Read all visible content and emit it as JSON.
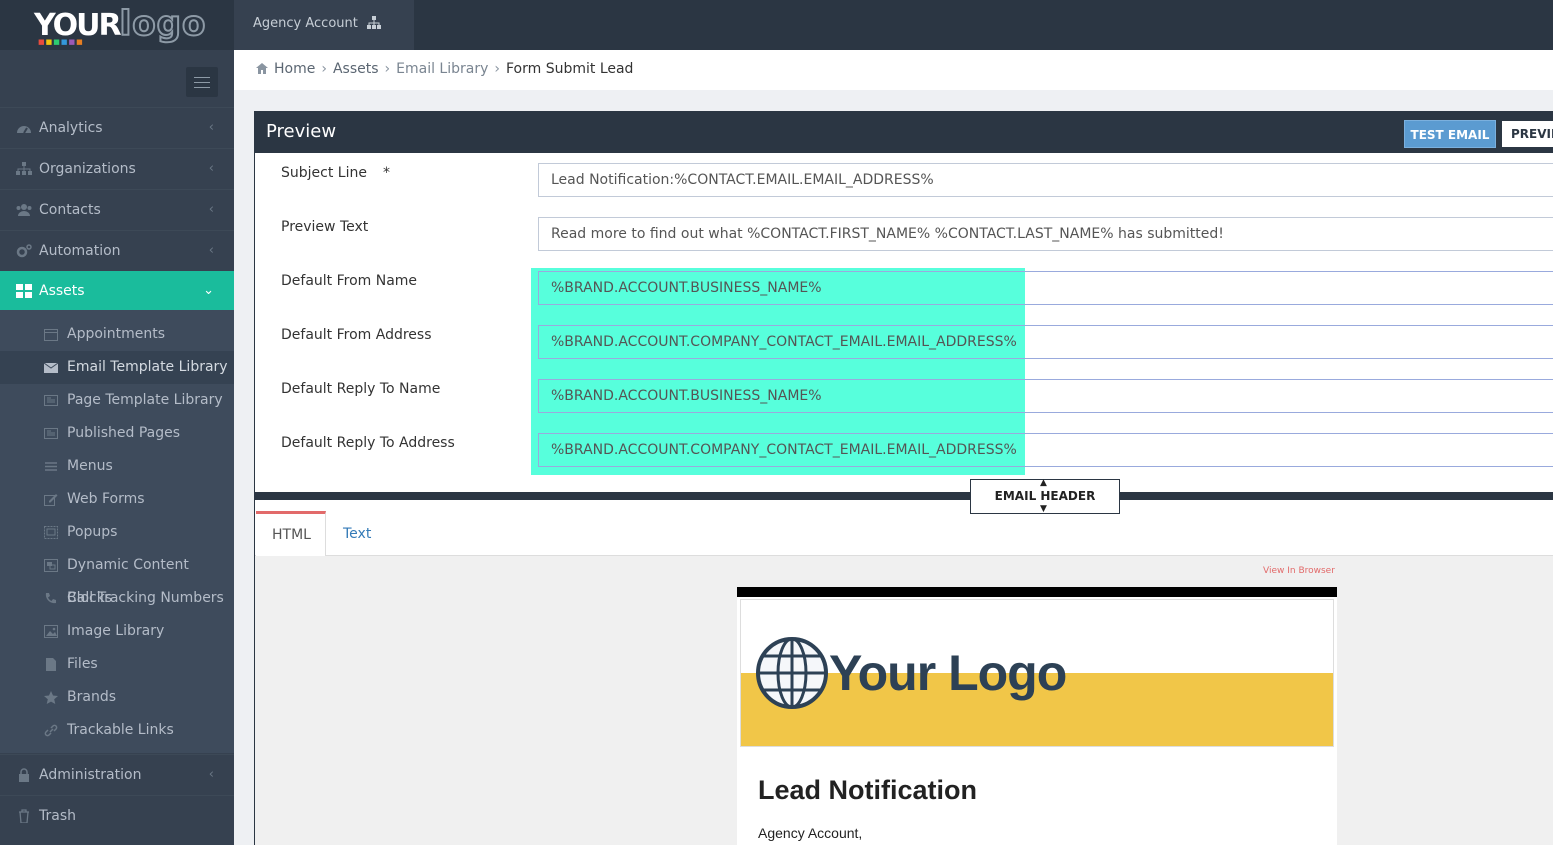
{
  "app": {
    "logo_text": "YOUR",
    "logo_text2": "logo",
    "account": "Agency Account"
  },
  "sidebar": {
    "items": [
      {
        "label": "Analytics",
        "icon": "dashboard-icon"
      },
      {
        "label": "Organizations",
        "icon": "sitemap-icon"
      },
      {
        "label": "Contacts",
        "icon": "users-icon"
      },
      {
        "label": "Automation",
        "icon": "cogs-icon"
      },
      {
        "label": "Assets",
        "icon": "grid-icon"
      }
    ],
    "sub_items": [
      {
        "label": "Appointments"
      },
      {
        "label": "Email Template Library"
      },
      {
        "label": "Page Template Library"
      },
      {
        "label": "Published Pages"
      },
      {
        "label": "Menus"
      },
      {
        "label": "Web Forms"
      },
      {
        "label": "Popups"
      },
      {
        "label": "Dynamic Content Blocks"
      },
      {
        "label": "Call Tracking Numbers"
      },
      {
        "label": "Image Library"
      },
      {
        "label": "Files"
      },
      {
        "label": "Brands"
      },
      {
        "label": "Trackable Links"
      }
    ],
    "bottom_items": [
      {
        "label": "Administration"
      },
      {
        "label": "Trash"
      }
    ]
  },
  "breadcrumb": {
    "home": "Home",
    "assets": "Assets",
    "library": "Email Library",
    "current": "Form Submit Lead"
  },
  "panel": {
    "title": "Preview",
    "test_email": "TEST EMAIL",
    "preview": "PREVIEW"
  },
  "form": {
    "subject_label": "Subject Line",
    "required_mark": "*",
    "subject_value": "Lead Notification:%CONTACT.EMAIL.EMAIL_ADDRESS%",
    "preview_label": "Preview Text",
    "preview_value": "Read more to find out what %CONTACT.FIRST_NAME% %CONTACT.LAST_NAME%  has submitted!",
    "from_name_label": "Default From Name",
    "from_name_value": "%BRAND.ACCOUNT.BUSINESS_NAME%",
    "from_address_label": "Default From Address",
    "from_address_value": "%BRAND.ACCOUNT.COMPANY_CONTACT_EMAIL.EMAIL_ADDRESS%",
    "reply_name_label": "Default Reply To Name",
    "reply_name_value": "%BRAND.ACCOUNT.BUSINESS_NAME%",
    "reply_address_label": "Default Reply To Address",
    "reply_address_value": "%BRAND.ACCOUNT.COMPANY_CONTACT_EMAIL.EMAIL_ADDRESS%"
  },
  "email_header_toggle": "EMAIL HEADER",
  "tabs": [
    "HTML",
    "Text"
  ],
  "email": {
    "view_in_browser": "View In Browser",
    "brand": "Your Logo",
    "heading": "Lead Notification",
    "greeting": "Agency Account,"
  },
  "colors": {
    "sidebar": "#364150",
    "topbar": "#2b3643",
    "accent": "#1abc9c",
    "highlight": "#57ffdc",
    "button": "#5b9bd1"
  }
}
